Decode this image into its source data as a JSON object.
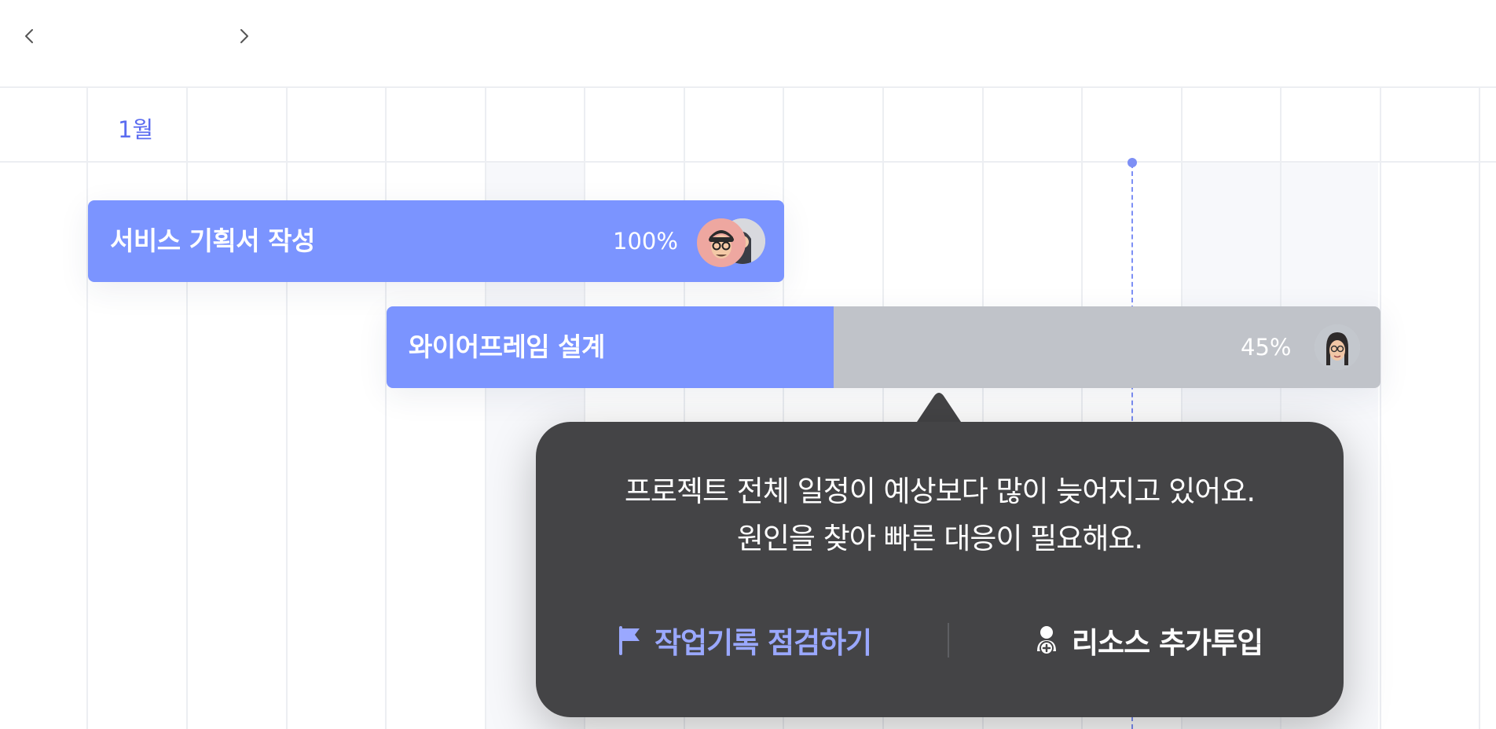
{
  "nav": {
    "prev_icon": "chevron-left-icon",
    "next_icon": "chevron-right-icon"
  },
  "timeline": {
    "month_label": "1월"
  },
  "tasks": [
    {
      "name": "서비스 기획서 작성",
      "progress_label": "100%",
      "progress": 1.0,
      "assignees": [
        "avatar-man-glasses",
        "avatar-person-hood"
      ]
    },
    {
      "name": "와이어프레임 설계",
      "progress_label": "45%",
      "progress": 0.45,
      "assignees": [
        "avatar-woman-braids"
      ]
    }
  ],
  "tooltip": {
    "message_line1": "프로젝트 전체 일정이 예상보다 많이 늦어지고 있어요.",
    "message_line2": "원인을 찾아 빠른 대응이 필요해요.",
    "action_primary": "작업기록 점검하기",
    "action_secondary": "리소스 추가투입",
    "action_primary_icon": "flag-icon",
    "action_secondary_icon": "person-add-icon"
  },
  "colors": {
    "accent": "#7b94ff",
    "remaining": "#c0c3c9",
    "tooltip_bg": "#444446",
    "month_text": "#5b6cf0",
    "link": "#9aa8ff"
  }
}
